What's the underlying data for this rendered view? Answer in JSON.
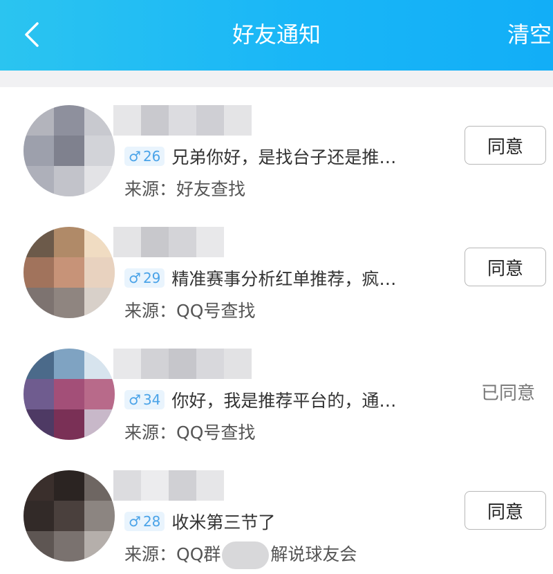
{
  "header": {
    "back_icon": "chevron-left-icon",
    "title": "好友通知",
    "clear_label": "清空"
  },
  "requests": [
    {
      "gender_symbol": "♂",
      "age": "26",
      "message": "兄弟你好，是找台子还是推…",
      "source_prefix": "来源：",
      "source": "好友查找",
      "action_label": "同意",
      "accepted": false,
      "avatar_colors": [
        "#b3b4bc",
        "#8e909d",
        "#c8c9cf",
        "#9da0ac",
        "#7f818e",
        "#d2d3d8",
        "#aeb0ba",
        "#c2c3ca",
        "#e3e3e6"
      ],
      "name_colors": [
        "#e6e6e8",
        "#c9c9ce",
        "#dcdce0",
        "#cfcfd4",
        "#e4e4e6"
      ]
    },
    {
      "gender_symbol": "♂",
      "age": "29",
      "message": "精准赛事分析红单推荐，疯…",
      "source_prefix": "来源：",
      "source": "QQ号查找",
      "action_label": "同意",
      "accepted": false,
      "avatar_colors": [
        "#6c5a4a",
        "#b08a68",
        "#f0dcc2",
        "#a1735c",
        "#c79378",
        "#e8d2bf",
        "#7d7370",
        "#8f8580",
        "#d8d0c9"
      ],
      "name_colors": [
        "#e4e4e6",
        "#c8c8cc",
        "#d4d4d8",
        "#e8e8ea"
      ]
    },
    {
      "gender_symbol": "♂",
      "age": "34",
      "message": "你好，我是推荐平台的，通…",
      "source_prefix": "来源：",
      "source": "QQ号查找",
      "action_label": "同意",
      "accepted": true,
      "accepted_label": "已同意",
      "avatar_colors": [
        "#4b6a8a",
        "#7fa3c2",
        "#d7e4ee",
        "#6f5c8f",
        "#a34f78",
        "#b86a8a",
        "#4e3a64",
        "#7a3056",
        "#c8b8c9"
      ],
      "name_colors": [
        "#e8e8ea",
        "#d2d2d6",
        "#c6c6cb",
        "#d8d8dc",
        "#e2e2e4"
      ]
    },
    {
      "gender_symbol": "♂",
      "age": "28",
      "message": "收米第三节了",
      "source_prefix": "来源：",
      "source_start": "QQ群",
      "source_end": "解说球友会",
      "action_label": "同意",
      "accepted": false,
      "avatar_colors": [
        "#3a2f2c",
        "#2b2422",
        "#6e6662",
        "#322a28",
        "#4a403d",
        "#8c8581",
        "#5e5653",
        "#7a726f",
        "#b5afab"
      ],
      "name_colors": [
        "#dcdcdf",
        "#ececee",
        "#d0d0d4",
        "#e6e6e8"
      ]
    }
  ]
}
